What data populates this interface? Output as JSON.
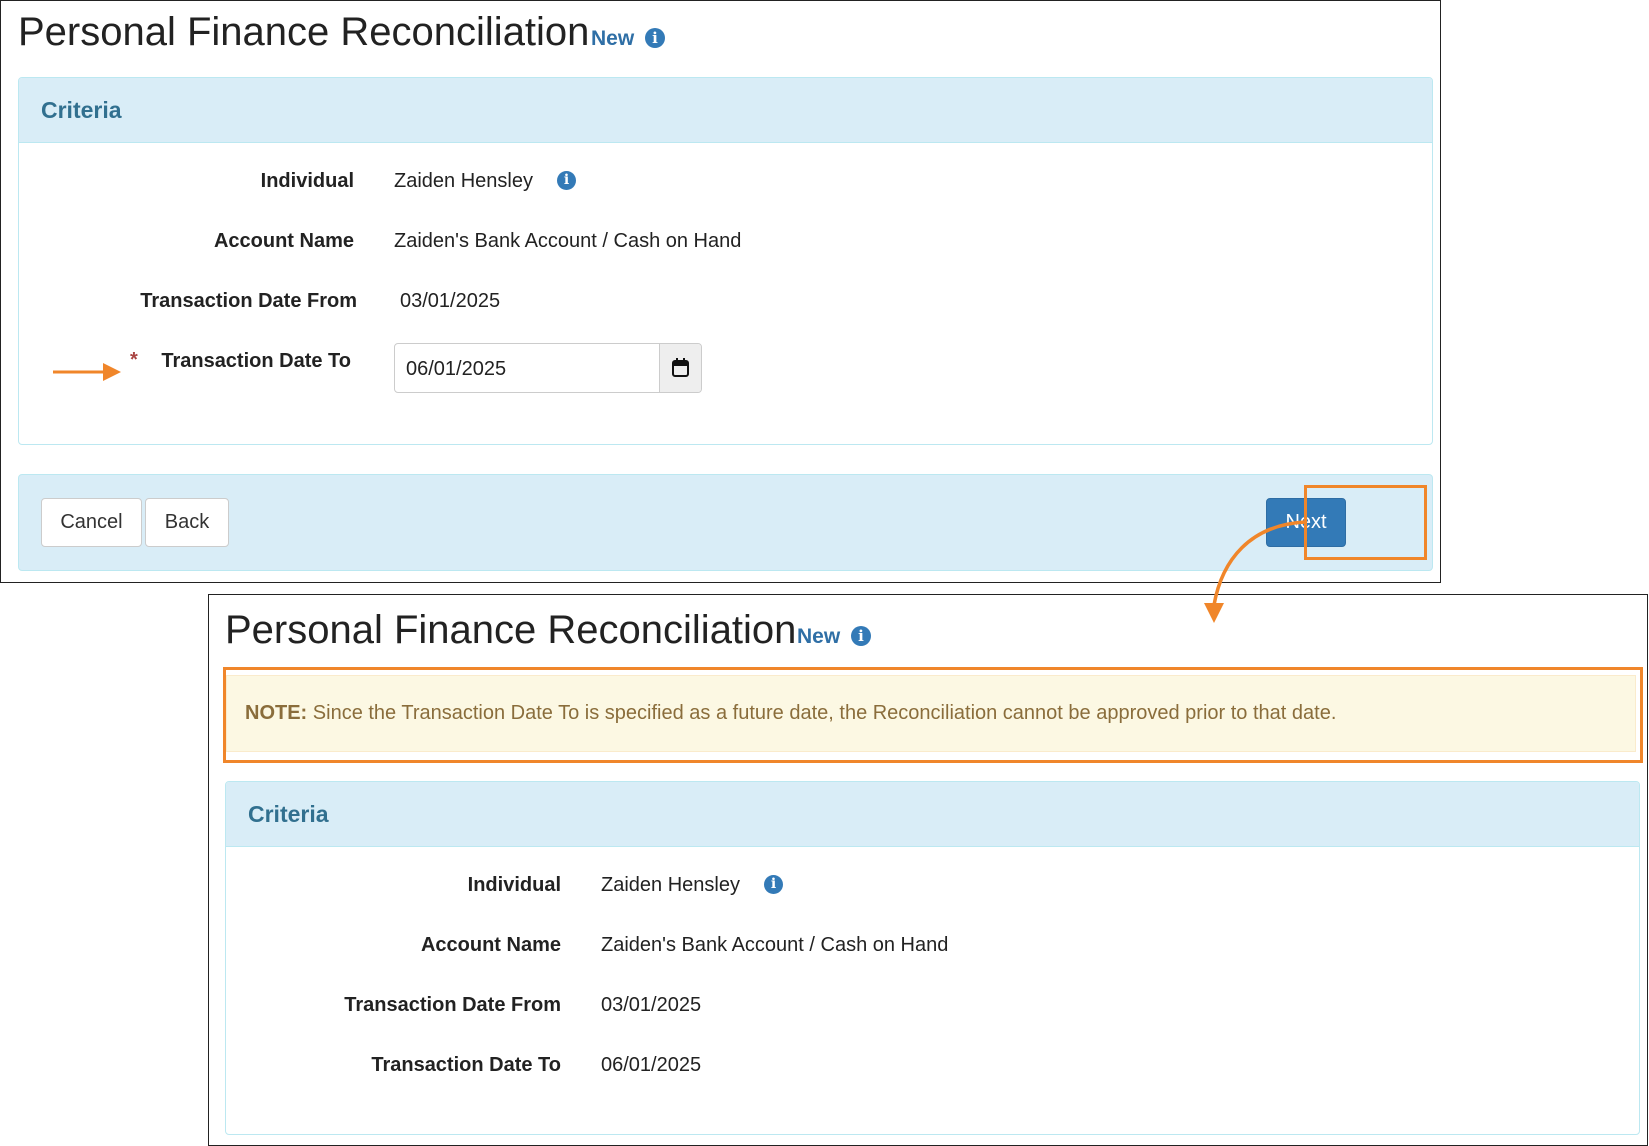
{
  "top_screen": {
    "title": "Personal Finance Reconciliation",
    "badge": "New",
    "criteria_heading": "Criteria",
    "fields": {
      "individual_label": "Individual",
      "individual_value": "Zaiden Hensley",
      "account_label": "Account Name",
      "account_value": "Zaiden's Bank Account / Cash on Hand",
      "date_from_label": "Transaction Date From",
      "date_from_value": "03/01/2025",
      "date_to_required_mark": "*",
      "date_to_label": "Transaction Date To",
      "date_to_value": "06/01/2025"
    },
    "buttons": {
      "cancel": "Cancel",
      "back": "Back",
      "next": "Next"
    }
  },
  "bottom_screen": {
    "title": "Personal Finance Reconciliation",
    "badge": "New",
    "note_prefix": "NOTE:",
    "note_text": "Since the Transaction Date To is specified as a future date, the Reconciliation cannot be approved prior to that date.",
    "criteria_heading": "Criteria",
    "fields": {
      "individual_label": "Individual",
      "individual_value": "Zaiden Hensley",
      "account_label": "Account Name",
      "account_value": "Zaiden's Bank Account / Cash on Hand",
      "date_from_label": "Transaction Date From",
      "date_from_value": "03/01/2025",
      "date_to_label": "Transaction Date To",
      "date_to_value": "06/01/2025"
    }
  },
  "icons": {
    "info": "info-circle-icon",
    "calendar": "calendar-icon",
    "annotation_arrow": "arrow-right-icon",
    "flow_arrow": "curved-arrow-icon"
  },
  "colors": {
    "accent": "#337ab7",
    "panel_heading_bg": "#d9edf7",
    "panel_heading_text": "#31708f",
    "note_bg": "#fcf8e3",
    "note_text": "#8a6d3b",
    "annotation": "#f0862a",
    "required": "#a94442"
  }
}
